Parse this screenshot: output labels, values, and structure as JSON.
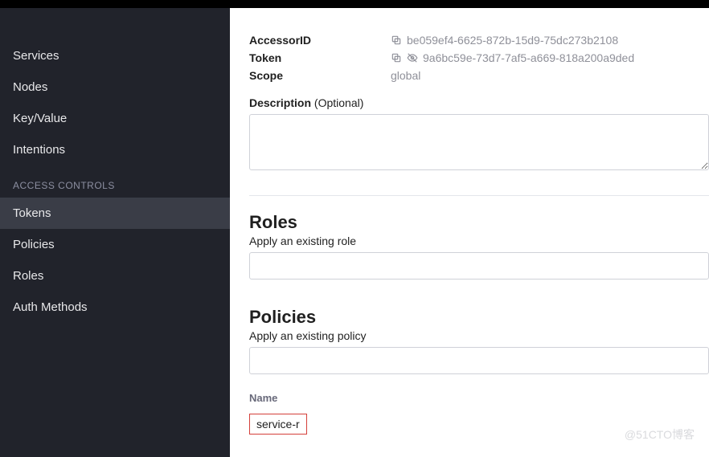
{
  "sidebar": {
    "primary": [
      {
        "label": "Services"
      },
      {
        "label": "Nodes"
      },
      {
        "label": "Key/Value"
      },
      {
        "label": "Intentions"
      }
    ],
    "section_header": "ACCESS CONTROLS",
    "access": [
      {
        "label": "Tokens",
        "active": true
      },
      {
        "label": "Policies"
      },
      {
        "label": "Roles"
      },
      {
        "label": "Auth Methods"
      }
    ]
  },
  "main": {
    "accessor_label": "AccessorID",
    "accessor_value": "be059ef4-6625-872b-15d9-75dc273b2108",
    "token_label": "Token",
    "token_value": "9a6bc59e-73d7-7af5-a669-818a200a9ded",
    "scope_label": "Scope",
    "scope_value": "global",
    "description_label": "Description",
    "description_optional": "(Optional)",
    "description_value": "",
    "roles_title": "Roles",
    "roles_sub": "Apply an existing role",
    "roles_value": "",
    "policies_title": "Policies",
    "policies_sub": "Apply an existing policy",
    "policies_value": "",
    "name_label": "Name",
    "name_value": "service-r"
  },
  "watermark": "@51CTO博客"
}
